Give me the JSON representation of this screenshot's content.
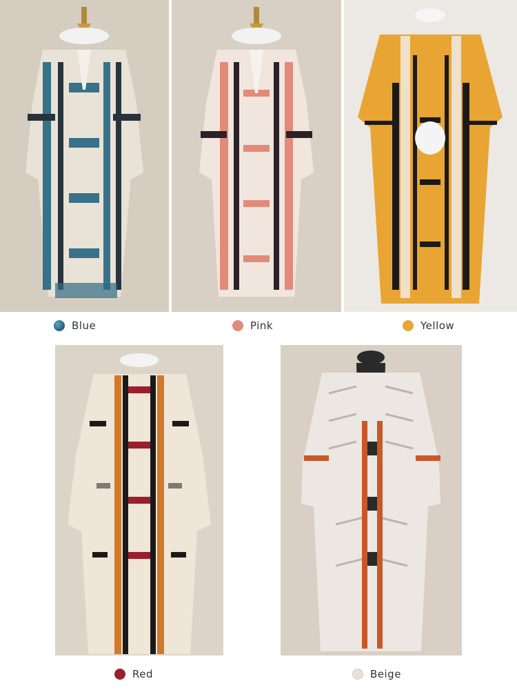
{
  "variants": [
    {
      "id": "blue",
      "label": "Blue",
      "color": "#2f6c86",
      "accent": "#1e4f66",
      "base": "#ece6dc"
    },
    {
      "id": "pink",
      "label": "Pink",
      "color": "#e38a7a",
      "accent": "#2a2226",
      "base": "#f2e8e0"
    },
    {
      "id": "yellow",
      "label": "Yellow",
      "color": "#e6a63a",
      "accent": "#1d1a16",
      "base": "#e8a534"
    },
    {
      "id": "red",
      "label": "Red",
      "color": "#9a1f2b",
      "accent": "#1c1a18",
      "base": "#efe6d8"
    },
    {
      "id": "beige",
      "label": "Beige",
      "color": "#e8e0db",
      "accent": "#c8582a",
      "base": "#ece7e2"
    }
  ]
}
